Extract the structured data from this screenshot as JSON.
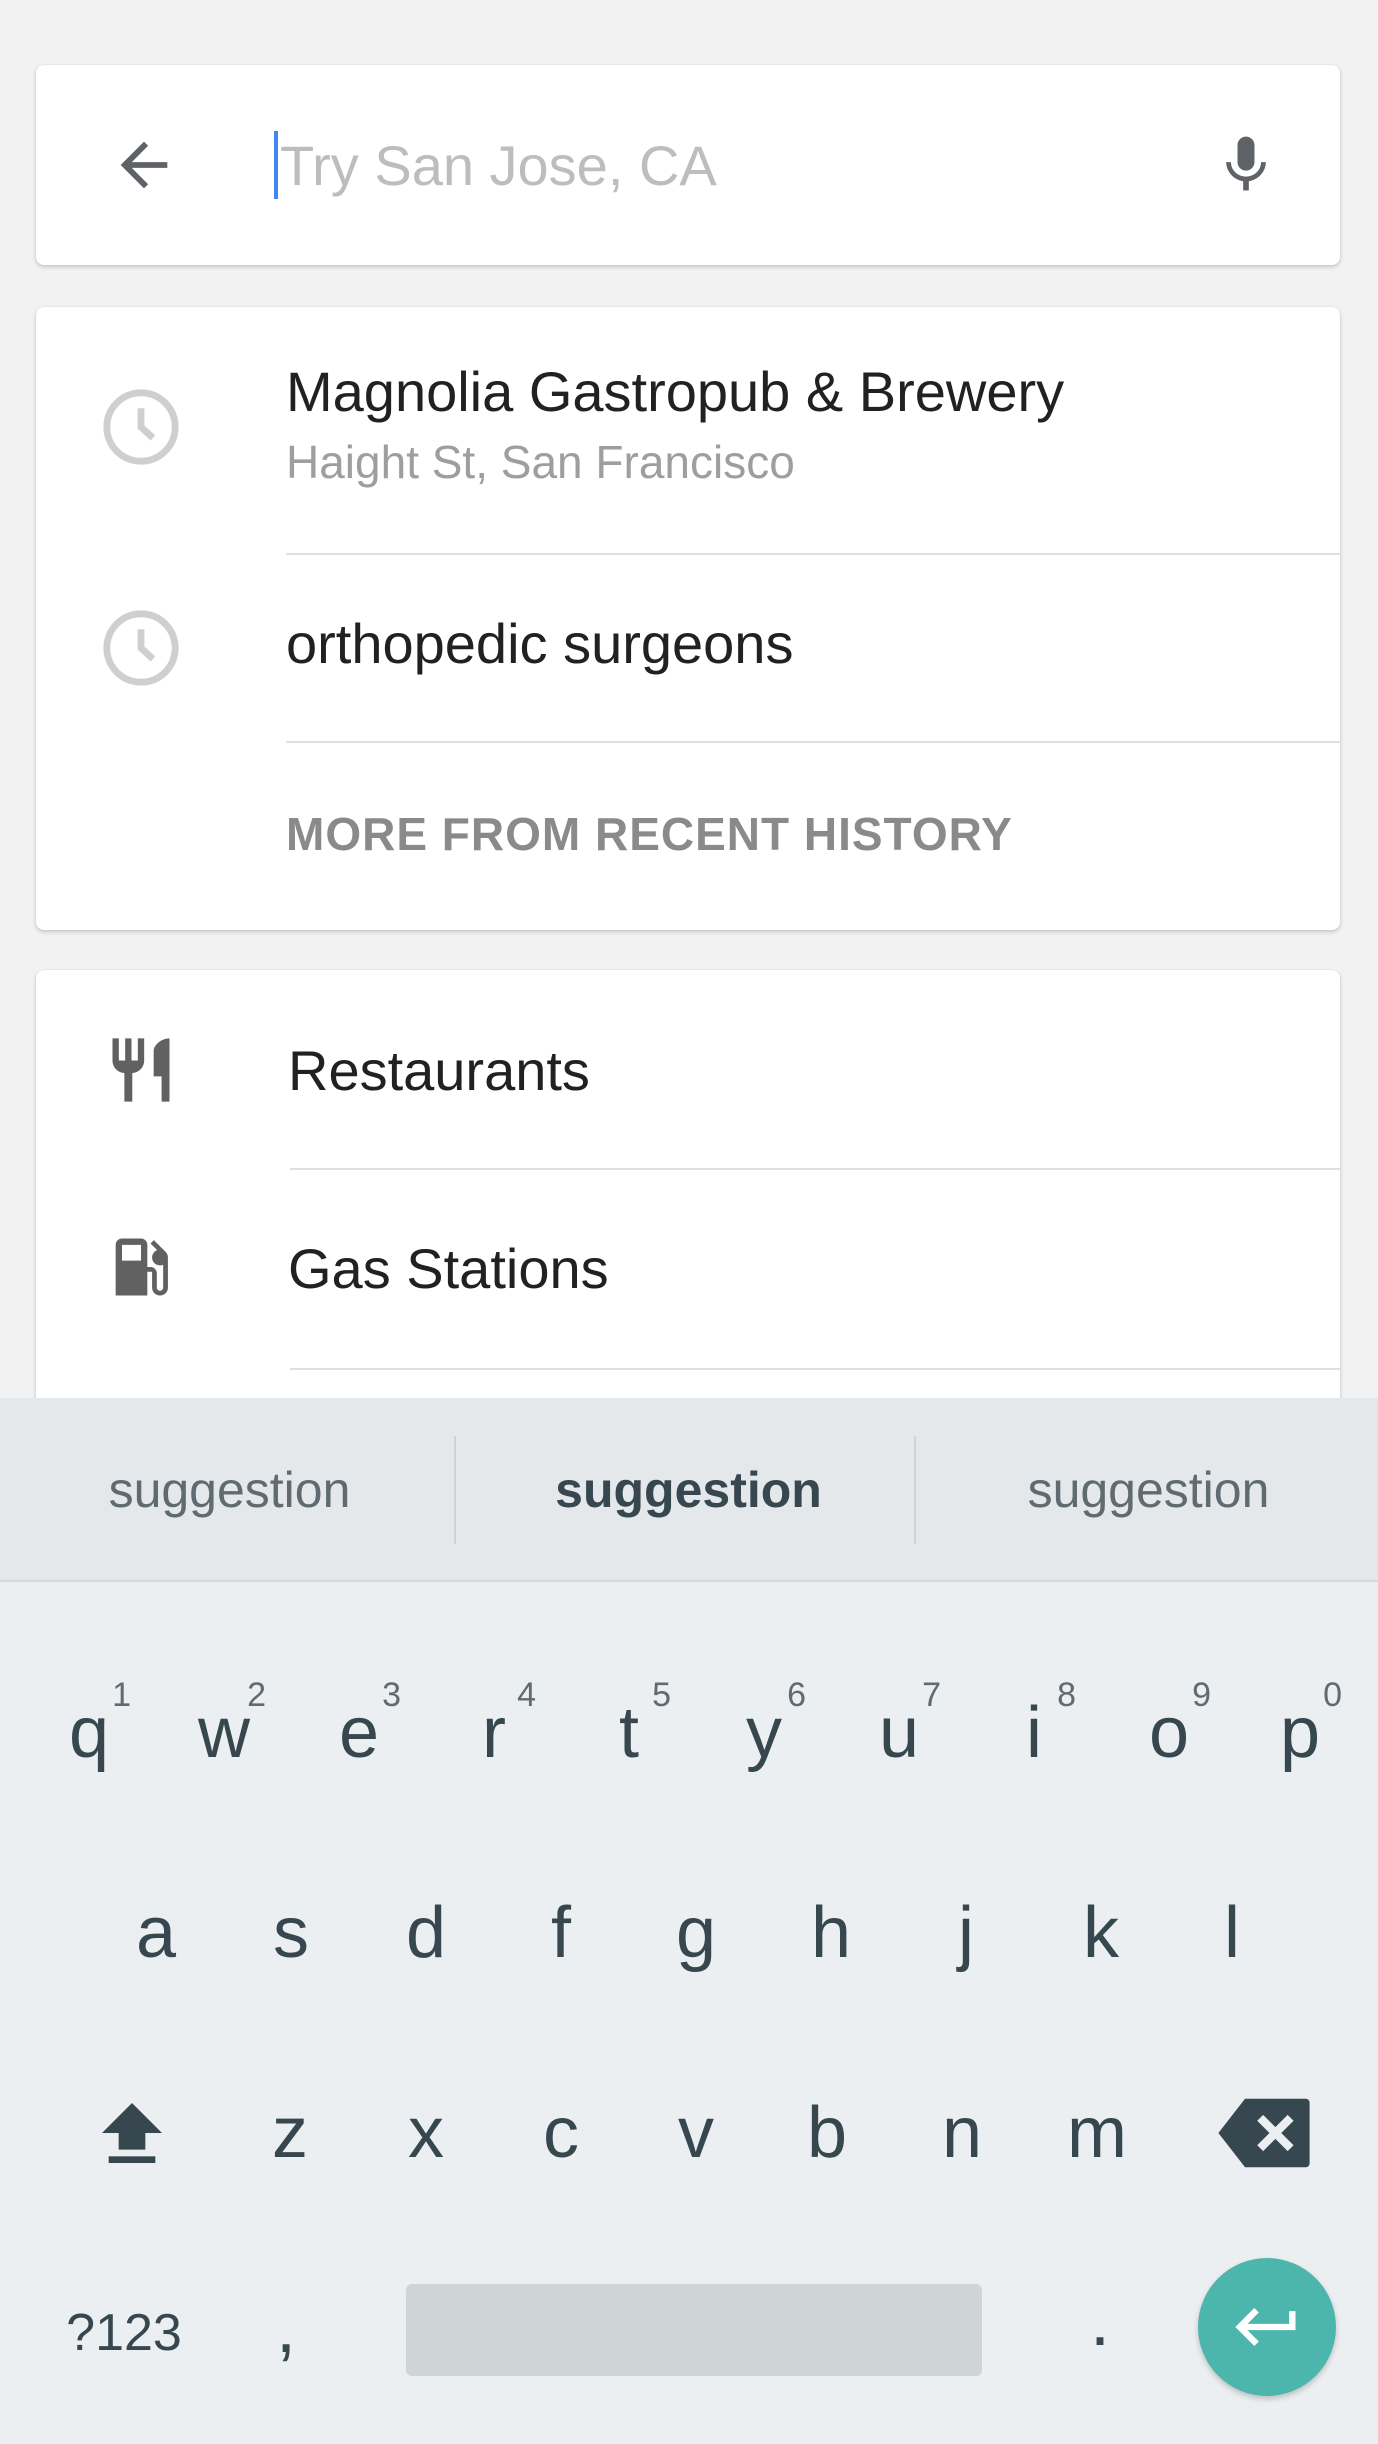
{
  "search": {
    "placeholder": "Try San Jose, CA"
  },
  "recent": {
    "items": [
      {
        "title": "Magnolia Gastropub & Brewery",
        "subtitle": "Haight St, San Francisco",
        "icon": "clock-icon"
      },
      {
        "title": "orthopedic surgeons",
        "icon": "clock-icon"
      }
    ],
    "more_label": "MORE FROM RECENT HISTORY"
  },
  "categories": {
    "items": [
      {
        "label": "Restaurants",
        "icon": "restaurant-icon"
      },
      {
        "label": "Gas Stations",
        "icon": "gas-station-icon"
      }
    ]
  },
  "keyboard": {
    "suggestions": [
      "suggestion",
      "suggestion",
      "suggestion"
    ],
    "row1": [
      {
        "key": "q",
        "hint": "1"
      },
      {
        "key": "w",
        "hint": "2"
      },
      {
        "key": "e",
        "hint": "3"
      },
      {
        "key": "r",
        "hint": "4"
      },
      {
        "key": "t",
        "hint": "5"
      },
      {
        "key": "y",
        "hint": "6"
      },
      {
        "key": "u",
        "hint": "7"
      },
      {
        "key": "i",
        "hint": "8"
      },
      {
        "key": "o",
        "hint": "9"
      },
      {
        "key": "p",
        "hint": "0"
      }
    ],
    "row2": [
      "a",
      "s",
      "d",
      "f",
      "g",
      "h",
      "j",
      "k",
      "l"
    ],
    "row3": [
      "z",
      "x",
      "c",
      "v",
      "b",
      "n",
      "m"
    ],
    "symbols_label": "?123",
    "comma": ",",
    "period": ".",
    "colors": {
      "enter": "#4db6ac",
      "caret": "#4285f4"
    }
  }
}
